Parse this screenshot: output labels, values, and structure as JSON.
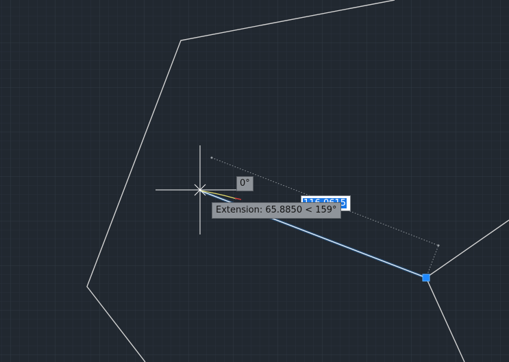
{
  "colors": {
    "background": "#212830",
    "grid_minor": "#2a323c",
    "grid_major": "#333c48",
    "geometry": "#d8d8d8",
    "selected_line": "#4aa8ff",
    "grip": "#1e88ff",
    "tooltip_bg": "#8f949a",
    "input_highlight": "#1976e6"
  },
  "cursor": {
    "icon": "crosshair-cursor-icon"
  },
  "tooltips": {
    "angle": "0°",
    "extension": "Extension: 65.8850 < 159°"
  },
  "dynamic_input": {
    "value": "116.0615"
  }
}
